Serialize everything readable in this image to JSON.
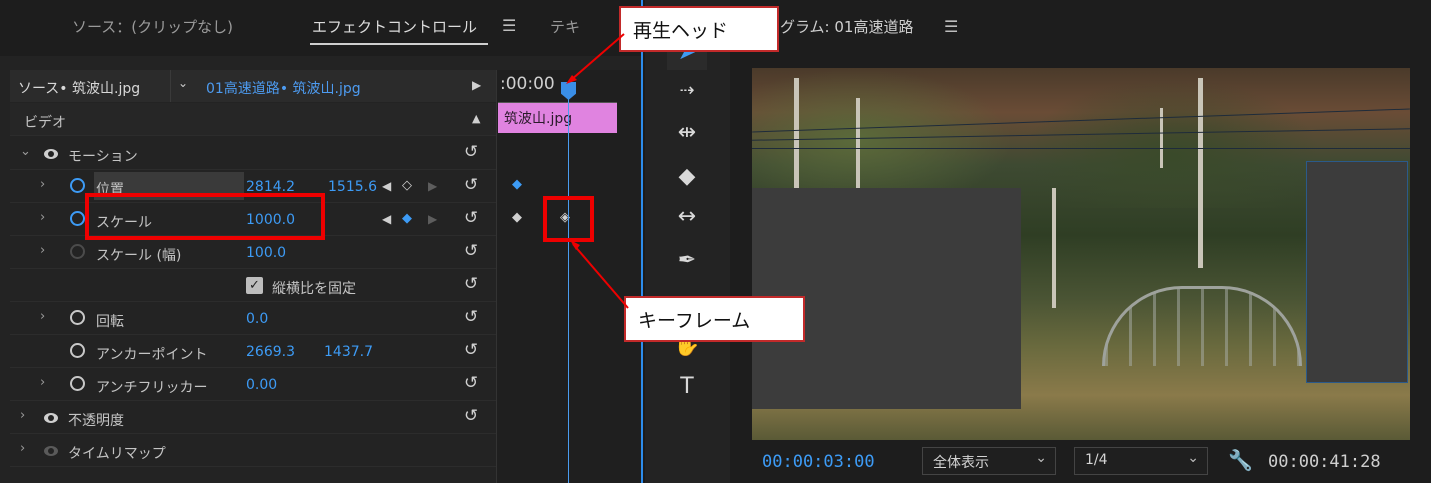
{
  "effects_panel": {
    "tabs": [
      {
        "label": "ソース：(クリップなし)"
      },
      {
        "label": "エフェクトコントロール"
      },
      {
        "label": "テキ"
      }
    ],
    "tab_menu_icon": "hamburger-icon",
    "source_bar": {
      "source_label": "ソース• 筑波山.jpg",
      "sequence_label": "01高速道路• 筑波山.jpg"
    },
    "section_video": "ビデオ",
    "timecode": ":00:00",
    "clip_name": "筑波山.jpg",
    "rows": {
      "motion": "モーション",
      "position": {
        "label": "位置",
        "x": "2814.2",
        "y": "1515.6"
      },
      "scale": {
        "label": "スケール",
        "value": "1000.0"
      },
      "scale_width": {
        "label": "スケール (幅)",
        "value": "100.0"
      },
      "uniform_scale": "縦横比を固定",
      "rotation": {
        "label": "回転",
        "value": "0.0"
      },
      "anchor": {
        "label": "アンカーポイント",
        "x": "2669.3",
        "y": "1437.7"
      },
      "anti_flicker": {
        "label": "アンチフリッカー",
        "value": "0.00"
      },
      "opacity": "不透明度",
      "time_remap": "タイムリマップ"
    }
  },
  "program": {
    "title": "グラム: 01高速道路",
    "current_time": "00:00:03:00",
    "zoom": "全体表示",
    "resolution": "1/4",
    "duration": "00:00:41:28"
  },
  "annotations": {
    "playhead_callout": "再生ヘッド",
    "keyframe_callout": "キーフレーム"
  },
  "colors": {
    "accent_blue": "#3d9bf5",
    "clip_pink": "#e083e0",
    "annotation_red": "#ee0000"
  }
}
